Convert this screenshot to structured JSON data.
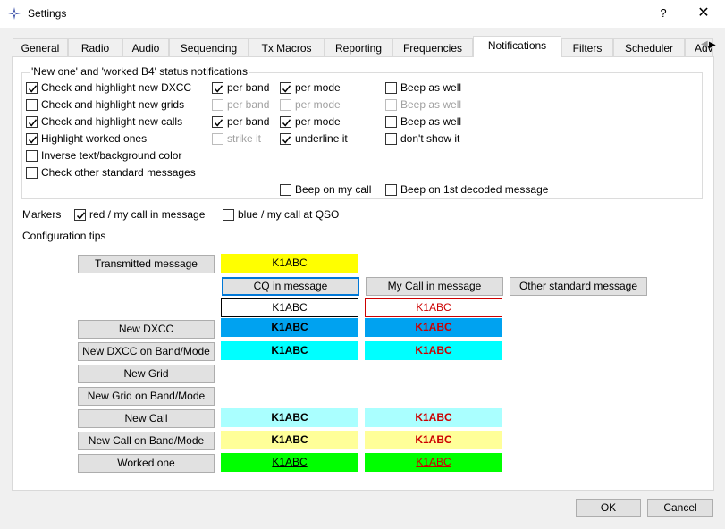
{
  "window": {
    "title": "Settings",
    "help": "?",
    "close": "✕"
  },
  "tabs": [
    "General",
    "Radio",
    "Audio",
    "Sequencing",
    "Tx Macros",
    "Reporting",
    "Frequencies",
    "Notifications",
    "Filters",
    "Scheduler",
    "Adv"
  ],
  "active_tab": "Notifications",
  "notifications": {
    "group_title": "'New one' and 'worked B4' status notifications",
    "rows": [
      {
        "main": "Check and highlight new DXCC",
        "per_band": "per band",
        "per_mode": "per mode",
        "beep": "Beep as well"
      },
      {
        "main": "Check and highlight new grids",
        "per_band": "per band",
        "per_mode": "per mode",
        "beep": "Beep as well"
      },
      {
        "main": "Check and highlight new calls",
        "per_band": "per band",
        "per_mode": "per mode",
        "beep": "Beep as well"
      },
      {
        "main": "Highlight worked ones",
        "strike": "strike it",
        "underline": "underline it",
        "dont_show": "don't show it"
      }
    ],
    "inverse": "Inverse text/background color",
    "other_std": "Check other standard messages",
    "beep_my_call": "Beep on my call",
    "beep_first": "Beep on 1st decoded message"
  },
  "markers": {
    "label": "Markers",
    "red": "red / my call in message",
    "blue": "blue / my call at QSO"
  },
  "config_tips": "Configuration tips",
  "buttons": {
    "transmitted": "Transmitted message",
    "cq": "CQ in message",
    "mycall": "My Call in message",
    "other": "Other standard message",
    "new_dxcc": "New DXCC",
    "new_dxcc_bm": "New DXCC on Band/Mode",
    "new_grid": "New Grid",
    "new_grid_bm": "New Grid on Band/Mode",
    "new_call": "New Call",
    "new_call_bm": "New Call on Band/Mode",
    "worked": "Worked one"
  },
  "sample_call": "K1ABC",
  "colors": {
    "accent": "#0078d7",
    "transmitted_bg": "#ffff00",
    "new_dxcc_bg": "#00a2f0",
    "new_dxcc_bm_bg": "#00ffff",
    "new_call_bg": "#aaffff",
    "new_call_bm_bg": "#ffff99",
    "worked_bg": "#00ff00",
    "mycall_text": "#cc0000"
  },
  "footer": {
    "ok": "OK",
    "cancel": "Cancel"
  }
}
